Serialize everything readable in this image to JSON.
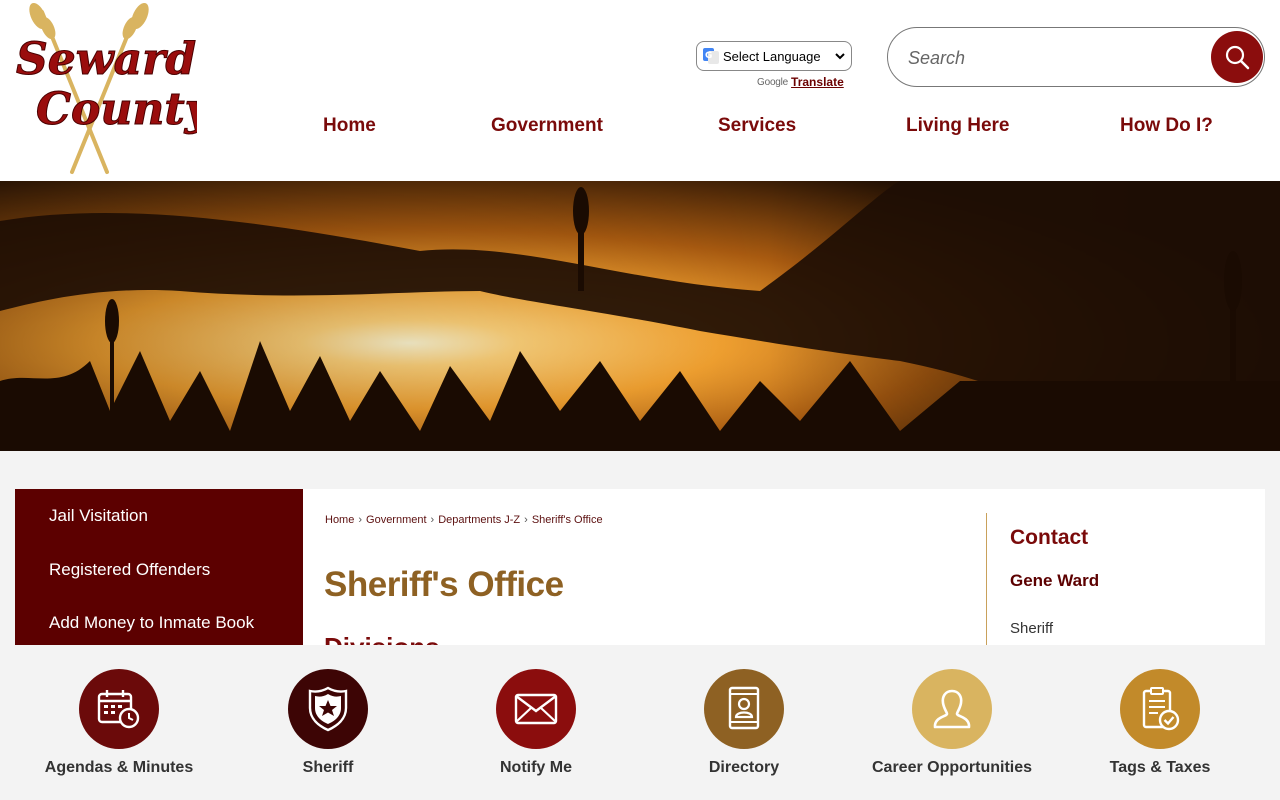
{
  "site": {
    "logo_text_line1": "Seward",
    "logo_text_line2": "County",
    "brand_color": "#7a0a0a"
  },
  "header": {
    "language_select": "Select Language",
    "powered_by": "Google",
    "translate_link": "Translate",
    "search_placeholder": "Search"
  },
  "nav": {
    "items": [
      {
        "label": "Home"
      },
      {
        "label": "Government"
      },
      {
        "label": "Services"
      },
      {
        "label": "Living Here"
      },
      {
        "label": "How Do I?"
      }
    ]
  },
  "sidebar": {
    "items": [
      {
        "label": "Jail Visitation"
      },
      {
        "label": "Registered Offenders"
      },
      {
        "label": "Add Money to Inmate Book"
      }
    ]
  },
  "breadcrumb": {
    "items": [
      "Home",
      "Government",
      "Departments J-Z",
      "Sheriff's Office"
    ]
  },
  "main": {
    "title": "Sheriff's Office",
    "subheading": "Divisions"
  },
  "contact": {
    "title": "Contact",
    "name": "Gene Ward",
    "role": "Sheriff"
  },
  "quick_links": [
    {
      "label": "Agendas & Minutes",
      "icon": "calendar-clock-icon",
      "color": "#6b0a0a"
    },
    {
      "label": "Sheriff",
      "icon": "sheriff-badge-icon",
      "color": "#3d0505"
    },
    {
      "label": "Notify Me",
      "icon": "envelope-icon",
      "color": "#8b0d0d"
    },
    {
      "label": "Directory",
      "icon": "directory-book-icon",
      "color": "#8e6123"
    },
    {
      "label": "Career Opportunities",
      "icon": "person-icon",
      "color": "#d9b460"
    },
    {
      "label": "Tags & Taxes",
      "icon": "clipboard-check-icon",
      "color": "#c28a2a"
    }
  ]
}
